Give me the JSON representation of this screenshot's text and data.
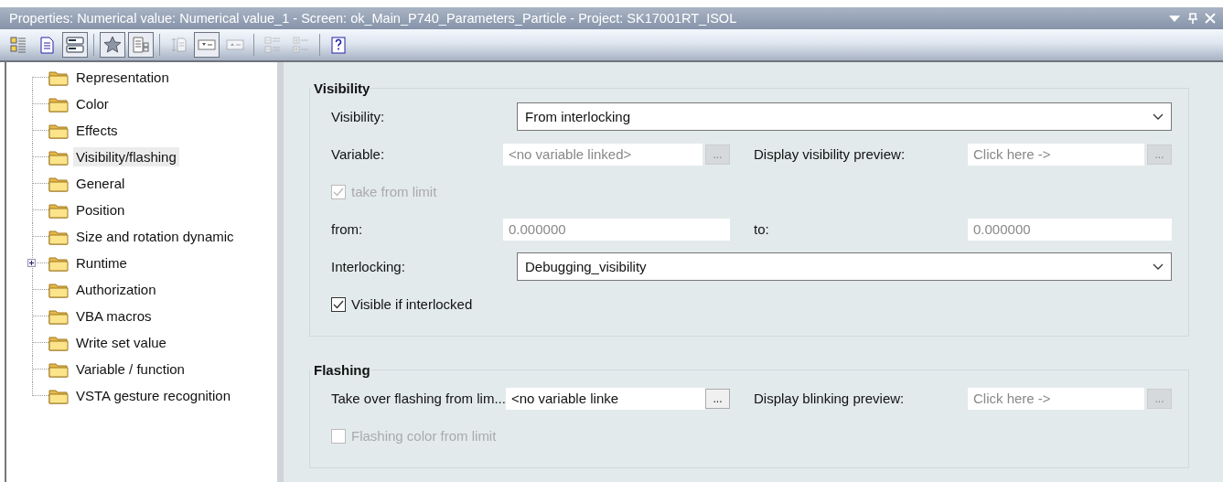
{
  "window": {
    "title": "Properties: Numerical value: Numerical value_1 - Screen: ok_Main_P740_Parameters_Particle - Project: SK17001RT_ISOL"
  },
  "toolbar": [
    {
      "kind": "button",
      "selected": false,
      "disabled": false
    },
    {
      "kind": "button",
      "selected": false,
      "disabled": false
    },
    {
      "kind": "button",
      "selected": true,
      "disabled": false
    },
    {
      "kind": "separator"
    },
    {
      "kind": "button",
      "selected": true,
      "disabled": false
    },
    {
      "kind": "button",
      "selected": true,
      "disabled": false
    },
    {
      "kind": "separator"
    },
    {
      "kind": "button",
      "selected": false,
      "disabled": true
    },
    {
      "kind": "button",
      "selected": true,
      "disabled": false
    },
    {
      "kind": "button",
      "selected": false,
      "disabled": true
    },
    {
      "kind": "separator"
    },
    {
      "kind": "button",
      "selected": false,
      "disabled": true
    },
    {
      "kind": "button",
      "selected": false,
      "disabled": true
    },
    {
      "kind": "separator"
    },
    {
      "kind": "button",
      "selected": false,
      "disabled": false
    }
  ],
  "tree": {
    "items": [
      {
        "label": "Representation",
        "kind": "leaf",
        "selected": false
      },
      {
        "label": "Color",
        "kind": "leaf",
        "selected": false
      },
      {
        "label": "Effects",
        "kind": "leaf",
        "selected": false
      },
      {
        "label": "Visibility/flashing",
        "kind": "leaf",
        "selected": true
      },
      {
        "label": "General",
        "kind": "leaf",
        "selected": false
      },
      {
        "label": "Position",
        "kind": "leaf",
        "selected": false
      },
      {
        "label": "Size and rotation dynamic",
        "kind": "leaf",
        "selected": false
      },
      {
        "label": "Runtime",
        "kind": "collapsed",
        "selected": false
      },
      {
        "label": "Authorization",
        "kind": "leaf",
        "selected": false
      },
      {
        "label": "VBA macros",
        "kind": "leaf",
        "selected": false
      },
      {
        "label": "Write set value",
        "kind": "leaf",
        "selected": false
      },
      {
        "label": "Variable / function",
        "kind": "leaf",
        "selected": false
      },
      {
        "label": "VSTA gesture recognition",
        "kind": "leaf",
        "selected": false
      }
    ]
  },
  "groups": [
    {
      "title": "Visibility",
      "rows": [
        {
          "kind": "dropdown",
          "label": "Visibility:",
          "value": "From interlocking"
        },
        {
          "kind": "pair",
          "left": {
            "label": "Variable:",
            "value": "<no variable linked>",
            "disabled": true,
            "button": "..."
          },
          "right": {
            "label": "Display visibility preview:",
            "value": "Click here ->",
            "disabled": true,
            "button": "..."
          }
        },
        {
          "kind": "checkbox",
          "label": "take from limit",
          "checked": true,
          "disabled": true
        },
        {
          "kind": "pair",
          "left": {
            "label": "from:",
            "value": "0.000000",
            "disabled": true
          },
          "right": {
            "label": "to:",
            "value": "0.000000",
            "disabled": true
          }
        },
        {
          "kind": "dropdown",
          "label": "Interlocking:",
          "value": "Debugging_visibility"
        },
        {
          "kind": "checkbox",
          "label": "Visible if interlocked",
          "checked": true,
          "disabled": false
        }
      ]
    },
    {
      "title": "Flashing",
      "rows": [
        {
          "kind": "pair",
          "left": {
            "label": "Take over flashing from lim...",
            "value": "<no variable linke",
            "disabled": false,
            "button": "..."
          },
          "right": {
            "label": "Display blinking preview:",
            "value": "Click here ->",
            "disabled": true,
            "button": "..."
          }
        },
        {
          "kind": "checkbox",
          "label": "Flashing color from limit",
          "checked": false,
          "disabled": true
        }
      ]
    }
  ]
}
